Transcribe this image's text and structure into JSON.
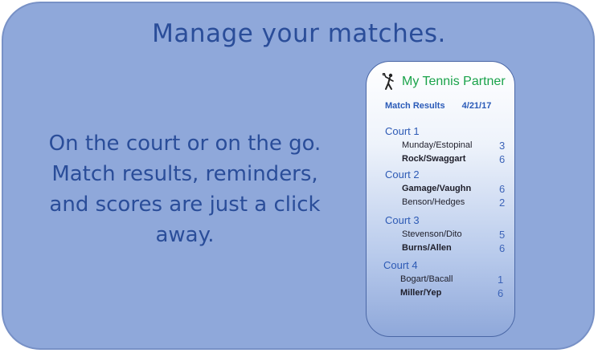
{
  "headline": "Manage your matches.",
  "tagline": [
    "On the court or on the go.",
    "Match results, reminders,",
    "and scores are just a click",
    "away."
  ],
  "app": {
    "icon": "tennis-player-icon",
    "title": "My Tennis Partner",
    "results_label": "Match Results",
    "results_date": "4/21/17"
  },
  "courts": [
    {
      "label": "Court 1",
      "teams": [
        {
          "name": "Munday/Estopinal",
          "score": "3",
          "winner": false
        },
        {
          "name": "Rock/Swaggart",
          "score": "6",
          "winner": true
        }
      ]
    },
    {
      "label": "Court 2",
      "teams": [
        {
          "name": "Gamage/Vaughn",
          "score": "6",
          "winner": true
        },
        {
          "name": "Benson/Hedges",
          "score": "2",
          "winner": false
        }
      ]
    },
    {
      "label": "Court 3",
      "teams": [
        {
          "name": "Stevenson/Dito",
          "score": "5",
          "winner": false
        },
        {
          "name": "Burns/Allen",
          "score": "6",
          "winner": true
        }
      ]
    },
    {
      "label": "Court 4",
      "teams": [
        {
          "name": "Bogart/Bacall",
          "score": "1",
          "winner": false
        },
        {
          "name": "Miller/Yep",
          "score": "6",
          "winner": true
        }
      ]
    }
  ],
  "colors": {
    "background": "#8fa8da",
    "headline": "#2a4d99",
    "app_title": "#1aa34a",
    "court_label": "#2d5ab5"
  }
}
